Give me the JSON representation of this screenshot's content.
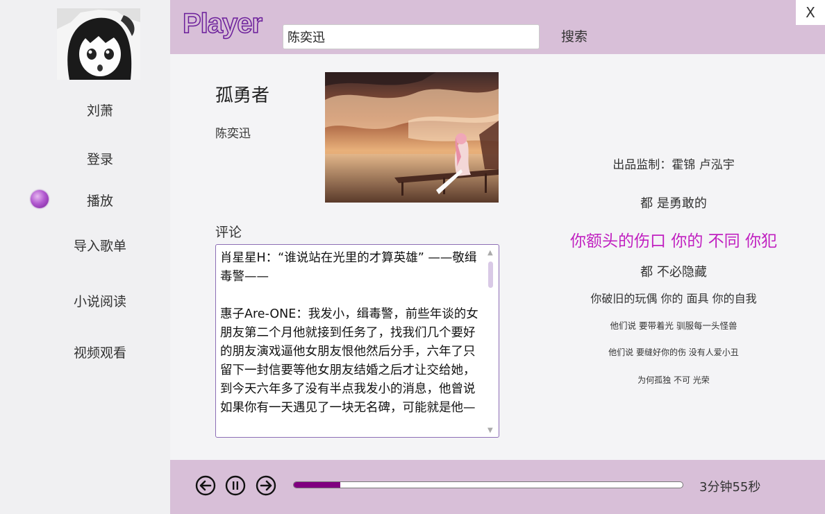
{
  "app": {
    "logo": "Player",
    "close_label": "X"
  },
  "search": {
    "value": "陈奕迅",
    "button_label": "搜索"
  },
  "sidebar": {
    "user_name": "刘萧",
    "items": [
      {
        "label": "登录"
      },
      {
        "label": "播放",
        "active": true
      },
      {
        "label": "导入歌单"
      },
      {
        "label": "小说阅读"
      },
      {
        "label": "视频观看"
      }
    ]
  },
  "song": {
    "title": "孤勇者",
    "artist": "陈奕迅"
  },
  "comments": {
    "label": "评论",
    "paragraphs": [
      "肖星星H：“谁说站在光里的才算英雄” ——敬缉毒警——",
      "",
      "惠子Are-ONE：我发小，缉毒警，前些年谈的女朋友第二个月他就接到任务了，找我们几个要好的朋友演戏逼他女朋友恨他然后分手，六年了只留下一封信要等他女朋友结婚之后才让交给她，到今天六年多了没有半点我发小的消息，他曾说如果你有一天遇见了一块无名碑，可能就是他—"
    ]
  },
  "lyrics": [
    {
      "text": "出品监制：霍锦 卢泓宇",
      "highlight": false
    },
    {
      "text": "都 是勇敢的",
      "highlight": false
    },
    {
      "text": "你额头的伤口 你的 不同 你犯",
      "highlight": true
    },
    {
      "text": "都 不必隐藏",
      "highlight": false
    },
    {
      "text": "你破旧的玩偶 你的 面具 你的自我",
      "highlight": false
    },
    {
      "text": "他们说 要带着光 驯服每一头怪兽",
      "highlight": false
    },
    {
      "text": "他们说 要缝好你的伤 没有人爱小丑",
      "highlight": false
    },
    {
      "text": "为何孤独 不可 光荣",
      "highlight": false
    }
  ],
  "player": {
    "progress": 0.12,
    "duration_text": "3分钟55秒"
  },
  "colors": {
    "accent": "#800080",
    "bar": "#d8bfd8",
    "lyric_highlight": "#c020c0"
  },
  "icons": [
    "prev-icon",
    "pause-icon",
    "next-icon",
    "close-icon"
  ]
}
